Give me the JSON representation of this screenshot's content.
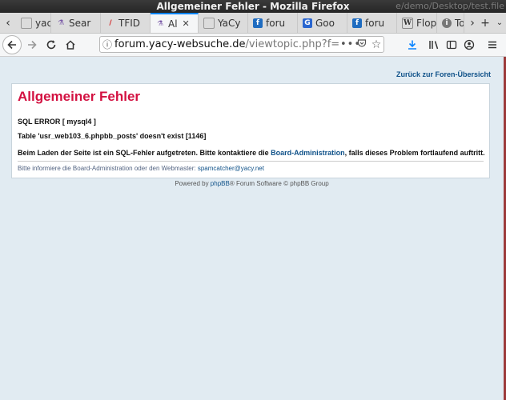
{
  "window": {
    "title": "Allgemeiner Fehler - Mozilla Firefox",
    "ghost_text": "e/demo/Desktop/test.file"
  },
  "tabs": [
    {
      "label": "yacy",
      "icon": "unknown",
      "color": "#e08a2a"
    },
    {
      "label": "Sear",
      "icon": "flask-icon",
      "color": "#7a5aa8"
    },
    {
      "label": "TFID",
      "icon": "slash-icon",
      "color": "#d32020"
    },
    {
      "label": "Al",
      "icon": "flask-icon",
      "color": "#7a5aa8",
      "active": true
    },
    {
      "label": "YaCy",
      "icon": "unknown",
      "color": "#e08a2a"
    },
    {
      "label": "foru",
      "icon": "page-icon",
      "color": "#1f6cc0"
    },
    {
      "label": "Goo",
      "icon": "translate-icon",
      "color": "#2a66d0"
    },
    {
      "label": "foru",
      "icon": "page-icon",
      "color": "#1f6cc0"
    },
    {
      "label": "Flop",
      "icon": "wikipedia-icon",
      "color": "#333333"
    },
    {
      "label": "To",
      "icon": "info-icon",
      "color": "#666666"
    }
  ],
  "navbar": {
    "url_domain": "forum.yacy-websuche.de",
    "url_path": "/viewtopic.php?f="
  },
  "page": {
    "back_link": "Zurück zur Foren-Übersicht",
    "error_title": "Allgemeiner Fehler",
    "sql_error": "SQL ERROR [ mysql4 ]",
    "table_error": "Table 'usr_web103_6.phpbb_posts' doesn't exist [1146]",
    "message_pre": "Beim Laden der Seite ist ein SQL-Fehler aufgetreten. Bitte kontaktiere die ",
    "message_link": "Board-Administration",
    "message_post": ", falls dieses Problem fortlaufend auftritt.",
    "inform_pre": "Bitte informiere die Board-Administration oder den Webmaster: ",
    "inform_link": "spamcatcher@yacy.net",
    "footer_pre": "Powered by ",
    "footer_link": "phpBB",
    "footer_post": "® Forum Software © phpBB Group"
  }
}
